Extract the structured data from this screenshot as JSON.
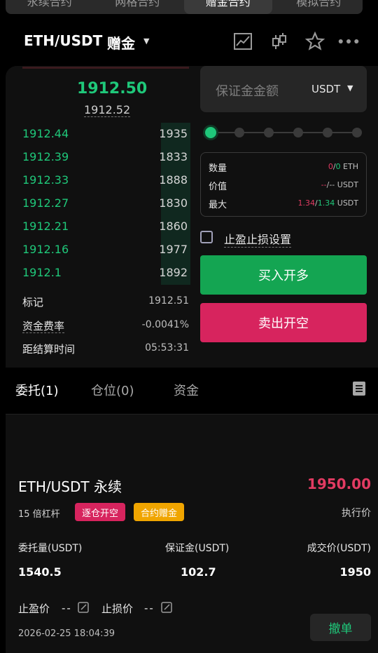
{
  "top_tabs": [
    "永续合约",
    "网格合约",
    "赠金合约",
    "模拟合约"
  ],
  "header": {
    "pair": "ETH/USDT",
    "subtitle": "赠金",
    "icons": [
      "chart-icon",
      "candlestick-icon",
      "star-icon",
      "more-icon"
    ]
  },
  "orderbook": {
    "last_price": "1912.50",
    "mark_price": "1912.52",
    "bids": [
      {
        "price": "1912.44",
        "qty": "1935"
      },
      {
        "price": "1912.39",
        "qty": "1833"
      },
      {
        "price": "1912.33",
        "qty": "1888"
      },
      {
        "price": "1912.27",
        "qty": "1830"
      },
      {
        "price": "1912.21",
        "qty": "1860"
      },
      {
        "price": "1912.16",
        "qty": "1977"
      },
      {
        "price": "1912.1",
        "qty": "1892"
      }
    ]
  },
  "info": {
    "mark_label": "标记",
    "mark_value": "1912.51",
    "funding_label": "资金费率",
    "funding_value": "-0.0041%",
    "settle_label": "距结算时间",
    "settle_value": "05:53:31"
  },
  "form": {
    "margin_placeholder": "保证金金额",
    "margin_unit": "USDT",
    "leverage_slider_value": 0,
    "stats": {
      "qty_label": "数量",
      "qty_a": "0",
      "qty_b": "0",
      "qty_unit": "ETH",
      "value_label": "价值",
      "value_a": "--",
      "value_b": "--",
      "value_unit": "USDT",
      "max_label": "最大",
      "max_a": "1.34",
      "max_b": "1.34",
      "max_unit": "USDT"
    },
    "tpsl_label": "止盈止损设置",
    "buy_label": "买入开多",
    "sell_label": "卖出开空"
  },
  "bottom_tabs": {
    "orders": "委托(1)",
    "positions": "仓位(0)",
    "funds": "资金"
  },
  "order": {
    "pair": "ETH/USDT 永续",
    "price": "1950.00",
    "leverage": "15 倍杠杆",
    "tag1": "逐仓开空",
    "tag2": "合约赠金",
    "exec_label": "执行价",
    "qty_label": "委托量(USDT)",
    "qty_value": "1540.5",
    "margin_label": "保证金(USDT)",
    "margin_value": "102.7",
    "fill_label": "成交价(USDT)",
    "fill_value": "1950",
    "tp_label": "止盈价",
    "tp_value": "--",
    "sl_label": "止损价",
    "sl_value": "--",
    "time": "2026-02-25 18:04:39",
    "cancel_label": "撤单"
  },
  "colors": {
    "green": "#1fc87a",
    "red": "#e23b62",
    "buy": "#14a552",
    "sell": "#d7245e",
    "tag1": "#d7245e",
    "tag2": "#f0a500"
  }
}
